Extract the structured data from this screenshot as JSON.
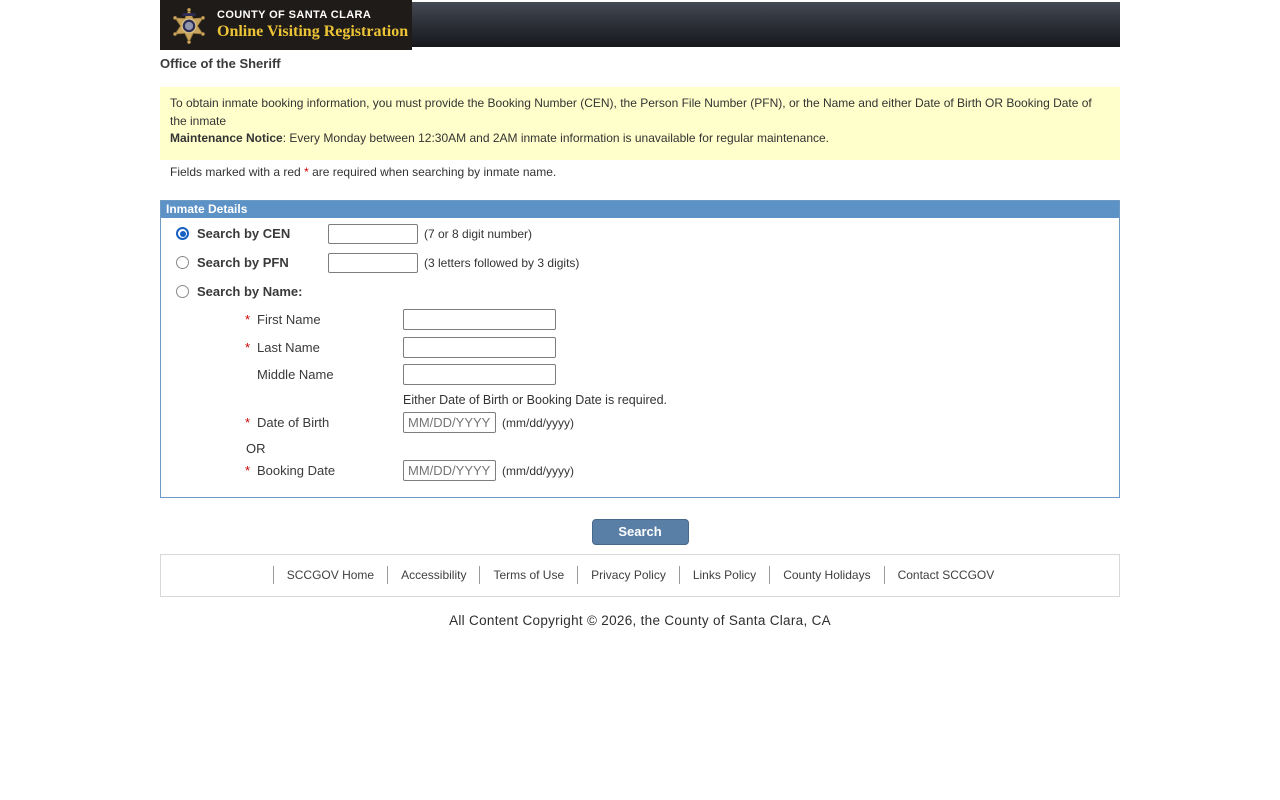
{
  "header": {
    "agency": "COUNTY OF SANTA CLARA",
    "app_title": "Online Visiting Registration",
    "page_heading": "Office of the Sheriff"
  },
  "notice": {
    "line1": "To obtain inmate booking information, you must provide the Booking Number (CEN), the Person File Number (PFN), or the Name and either Date of Birth OR Booking Date of the inmate",
    "maintenance_label": "Maintenance Notice",
    "maintenance_text": ": Every Monday between 12:30AM and 2AM inmate information is unavailable for regular maintenance."
  },
  "required_note": {
    "before": "Fields marked with a red ",
    "asterisk": "*",
    "after": " are required when searching by inmate name."
  },
  "form": {
    "section_title": "Inmate Details",
    "cen": {
      "label": "Search by CEN",
      "hint": "(7 or 8 digit number)",
      "value": "",
      "checked": true
    },
    "pfn": {
      "label": "Search by PFN",
      "hint": "(3 letters followed by 3 digits)",
      "value": "",
      "checked": false
    },
    "name": {
      "label": "Search by Name:",
      "checked": false
    },
    "first_name": {
      "asterisk": "*",
      "label": "First Name",
      "value": ""
    },
    "last_name": {
      "asterisk": "*",
      "label": "Last Name",
      "value": ""
    },
    "middle_name": {
      "label": "Middle Name",
      "value": ""
    },
    "date_note": "Either Date of Birth or Booking Date is required.",
    "dob": {
      "asterisk": "*",
      "label": "Date of Birth",
      "placeholder": "MM/DD/YYYY",
      "hint": "(mm/dd/yyyy)",
      "value": ""
    },
    "or_label": "OR",
    "booking_date": {
      "asterisk": "*",
      "label": "Booking Date",
      "placeholder": "MM/DD/YYYY",
      "hint": "(mm/dd/yyyy)",
      "value": ""
    },
    "search_button": "Search"
  },
  "footer": {
    "links": [
      "SCCGOV Home",
      "Accessibility",
      "Terms of Use",
      "Privacy Policy",
      "Links Policy",
      "County Holidays",
      "Contact SCCGOV"
    ],
    "copyright": "All Content Copyright © 2026, the County of Santa Clara, CA"
  },
  "colors": {
    "header_gold": "#eec437",
    "section_bar_blue": "#5d92c7",
    "button_blue": "#5a7fa7",
    "notice_yellow": "#ffffcc",
    "required_red": "#cc0000"
  }
}
